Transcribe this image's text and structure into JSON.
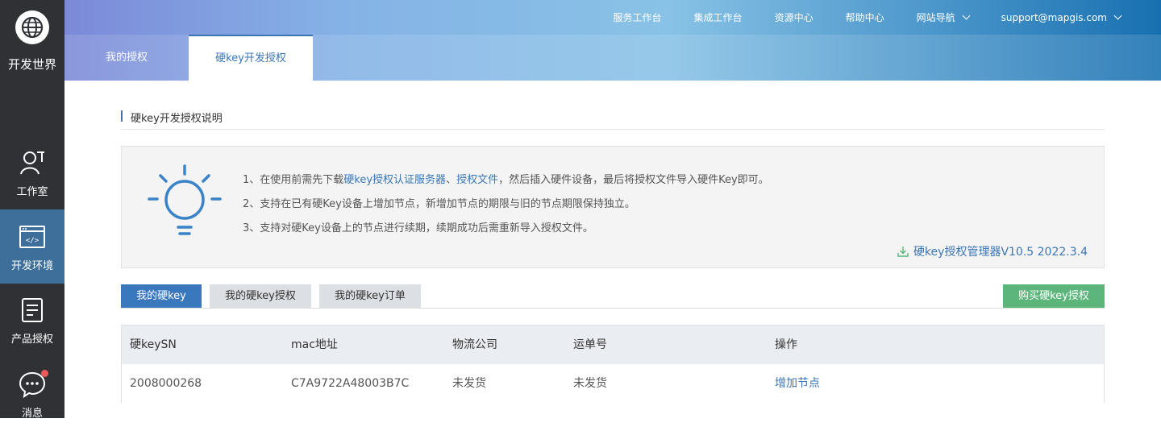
{
  "sidebar": {
    "logo_text": "开发世界",
    "items": [
      {
        "label": "工作室",
        "icon": "studio-icon"
      },
      {
        "label": "开发环境",
        "icon": "code-window-icon"
      },
      {
        "label": "产品授权",
        "icon": "license-scroll-icon"
      },
      {
        "label": "消息",
        "icon": "chat-bubble-icon"
      }
    ],
    "active_item": "开发环境"
  },
  "header": {
    "nav": [
      {
        "label": "服务工作台"
      },
      {
        "label": "集成工作台"
      },
      {
        "label": "资源中心"
      },
      {
        "label": "帮助中心"
      },
      {
        "label": "网站导航"
      },
      {
        "label": "support@mapgis.com"
      }
    ],
    "tabs": [
      {
        "label": "我的授权"
      },
      {
        "label": "硬key开发授权"
      }
    ],
    "active_tab": "硬key开发授权"
  },
  "section": {
    "title": "硬key开发授权说明"
  },
  "info": {
    "line1_prefix": "1、在使用前需先下载",
    "line1_link1": "硬key授权认证服务器",
    "line1_sep": "、",
    "line1_link2": "授权文件",
    "line1_suffix": "，然后插入硬件设备，最后将授权文件导入硬件Key即可。",
    "line2": "2、支持在已有硬Key设备上增加节点，新增加节点的期限与旧的节点期限保持独立。",
    "line3": "3、支持对硬Key设备上的节点进行续期，续期成功后需重新导入授权文件。",
    "download_label": "硬key授权管理器V10.5 2022.3.4"
  },
  "key_tabs": [
    {
      "label": "我的硬key"
    },
    {
      "label": "我的硬key授权"
    },
    {
      "label": "我的硬key订单"
    }
  ],
  "active_key_tab": "我的硬key",
  "buy_button": "购买硬key授权",
  "table": {
    "headers": [
      "硬keySN",
      "mac地址",
      "物流公司",
      "运单号",
      "操作"
    ],
    "rows": [
      [
        "2008000268",
        "C7A9722A48003B7C",
        "未发货",
        "未发货",
        "增加节点"
      ]
    ]
  },
  "colors": {
    "sidebar_bg": "#2f3135",
    "sidebar_active": "#3d6f9a",
    "accent_blue": "#3a76b4",
    "buy_green": "#5cb57a",
    "notify_red": "#ee5a5a"
  }
}
